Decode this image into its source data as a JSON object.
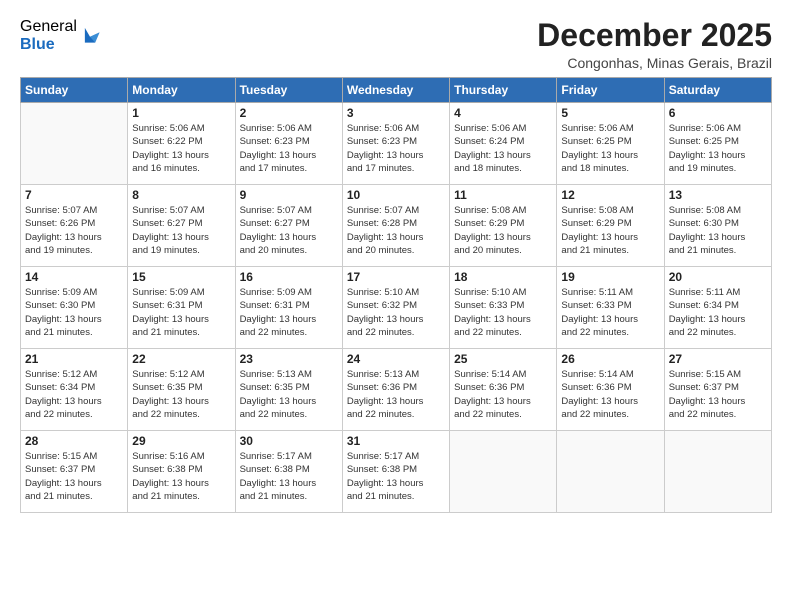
{
  "header": {
    "logo_general": "General",
    "logo_blue": "Blue",
    "month_title": "December 2025",
    "subtitle": "Congonhas, Minas Gerais, Brazil"
  },
  "weekdays": [
    "Sunday",
    "Monday",
    "Tuesday",
    "Wednesday",
    "Thursday",
    "Friday",
    "Saturday"
  ],
  "weeks": [
    [
      {
        "num": "",
        "info": ""
      },
      {
        "num": "1",
        "info": "Sunrise: 5:06 AM\nSunset: 6:22 PM\nDaylight: 13 hours\nand 16 minutes."
      },
      {
        "num": "2",
        "info": "Sunrise: 5:06 AM\nSunset: 6:23 PM\nDaylight: 13 hours\nand 17 minutes."
      },
      {
        "num": "3",
        "info": "Sunrise: 5:06 AM\nSunset: 6:23 PM\nDaylight: 13 hours\nand 17 minutes."
      },
      {
        "num": "4",
        "info": "Sunrise: 5:06 AM\nSunset: 6:24 PM\nDaylight: 13 hours\nand 18 minutes."
      },
      {
        "num": "5",
        "info": "Sunrise: 5:06 AM\nSunset: 6:25 PM\nDaylight: 13 hours\nand 18 minutes."
      },
      {
        "num": "6",
        "info": "Sunrise: 5:06 AM\nSunset: 6:25 PM\nDaylight: 13 hours\nand 19 minutes."
      }
    ],
    [
      {
        "num": "7",
        "info": "Sunrise: 5:07 AM\nSunset: 6:26 PM\nDaylight: 13 hours\nand 19 minutes."
      },
      {
        "num": "8",
        "info": "Sunrise: 5:07 AM\nSunset: 6:27 PM\nDaylight: 13 hours\nand 19 minutes."
      },
      {
        "num": "9",
        "info": "Sunrise: 5:07 AM\nSunset: 6:27 PM\nDaylight: 13 hours\nand 20 minutes."
      },
      {
        "num": "10",
        "info": "Sunrise: 5:07 AM\nSunset: 6:28 PM\nDaylight: 13 hours\nand 20 minutes."
      },
      {
        "num": "11",
        "info": "Sunrise: 5:08 AM\nSunset: 6:29 PM\nDaylight: 13 hours\nand 20 minutes."
      },
      {
        "num": "12",
        "info": "Sunrise: 5:08 AM\nSunset: 6:29 PM\nDaylight: 13 hours\nand 21 minutes."
      },
      {
        "num": "13",
        "info": "Sunrise: 5:08 AM\nSunset: 6:30 PM\nDaylight: 13 hours\nand 21 minutes."
      }
    ],
    [
      {
        "num": "14",
        "info": "Sunrise: 5:09 AM\nSunset: 6:30 PM\nDaylight: 13 hours\nand 21 minutes."
      },
      {
        "num": "15",
        "info": "Sunrise: 5:09 AM\nSunset: 6:31 PM\nDaylight: 13 hours\nand 21 minutes."
      },
      {
        "num": "16",
        "info": "Sunrise: 5:09 AM\nSunset: 6:31 PM\nDaylight: 13 hours\nand 22 minutes."
      },
      {
        "num": "17",
        "info": "Sunrise: 5:10 AM\nSunset: 6:32 PM\nDaylight: 13 hours\nand 22 minutes."
      },
      {
        "num": "18",
        "info": "Sunrise: 5:10 AM\nSunset: 6:33 PM\nDaylight: 13 hours\nand 22 minutes."
      },
      {
        "num": "19",
        "info": "Sunrise: 5:11 AM\nSunset: 6:33 PM\nDaylight: 13 hours\nand 22 minutes."
      },
      {
        "num": "20",
        "info": "Sunrise: 5:11 AM\nSunset: 6:34 PM\nDaylight: 13 hours\nand 22 minutes."
      }
    ],
    [
      {
        "num": "21",
        "info": "Sunrise: 5:12 AM\nSunset: 6:34 PM\nDaylight: 13 hours\nand 22 minutes."
      },
      {
        "num": "22",
        "info": "Sunrise: 5:12 AM\nSunset: 6:35 PM\nDaylight: 13 hours\nand 22 minutes."
      },
      {
        "num": "23",
        "info": "Sunrise: 5:13 AM\nSunset: 6:35 PM\nDaylight: 13 hours\nand 22 minutes."
      },
      {
        "num": "24",
        "info": "Sunrise: 5:13 AM\nSunset: 6:36 PM\nDaylight: 13 hours\nand 22 minutes."
      },
      {
        "num": "25",
        "info": "Sunrise: 5:14 AM\nSunset: 6:36 PM\nDaylight: 13 hours\nand 22 minutes."
      },
      {
        "num": "26",
        "info": "Sunrise: 5:14 AM\nSunset: 6:36 PM\nDaylight: 13 hours\nand 22 minutes."
      },
      {
        "num": "27",
        "info": "Sunrise: 5:15 AM\nSunset: 6:37 PM\nDaylight: 13 hours\nand 22 minutes."
      }
    ],
    [
      {
        "num": "28",
        "info": "Sunrise: 5:15 AM\nSunset: 6:37 PM\nDaylight: 13 hours\nand 21 minutes."
      },
      {
        "num": "29",
        "info": "Sunrise: 5:16 AM\nSunset: 6:38 PM\nDaylight: 13 hours\nand 21 minutes."
      },
      {
        "num": "30",
        "info": "Sunrise: 5:17 AM\nSunset: 6:38 PM\nDaylight: 13 hours\nand 21 minutes."
      },
      {
        "num": "31",
        "info": "Sunrise: 5:17 AM\nSunset: 6:38 PM\nDaylight: 13 hours\nand 21 minutes."
      },
      {
        "num": "",
        "info": ""
      },
      {
        "num": "",
        "info": ""
      },
      {
        "num": "",
        "info": ""
      }
    ]
  ]
}
